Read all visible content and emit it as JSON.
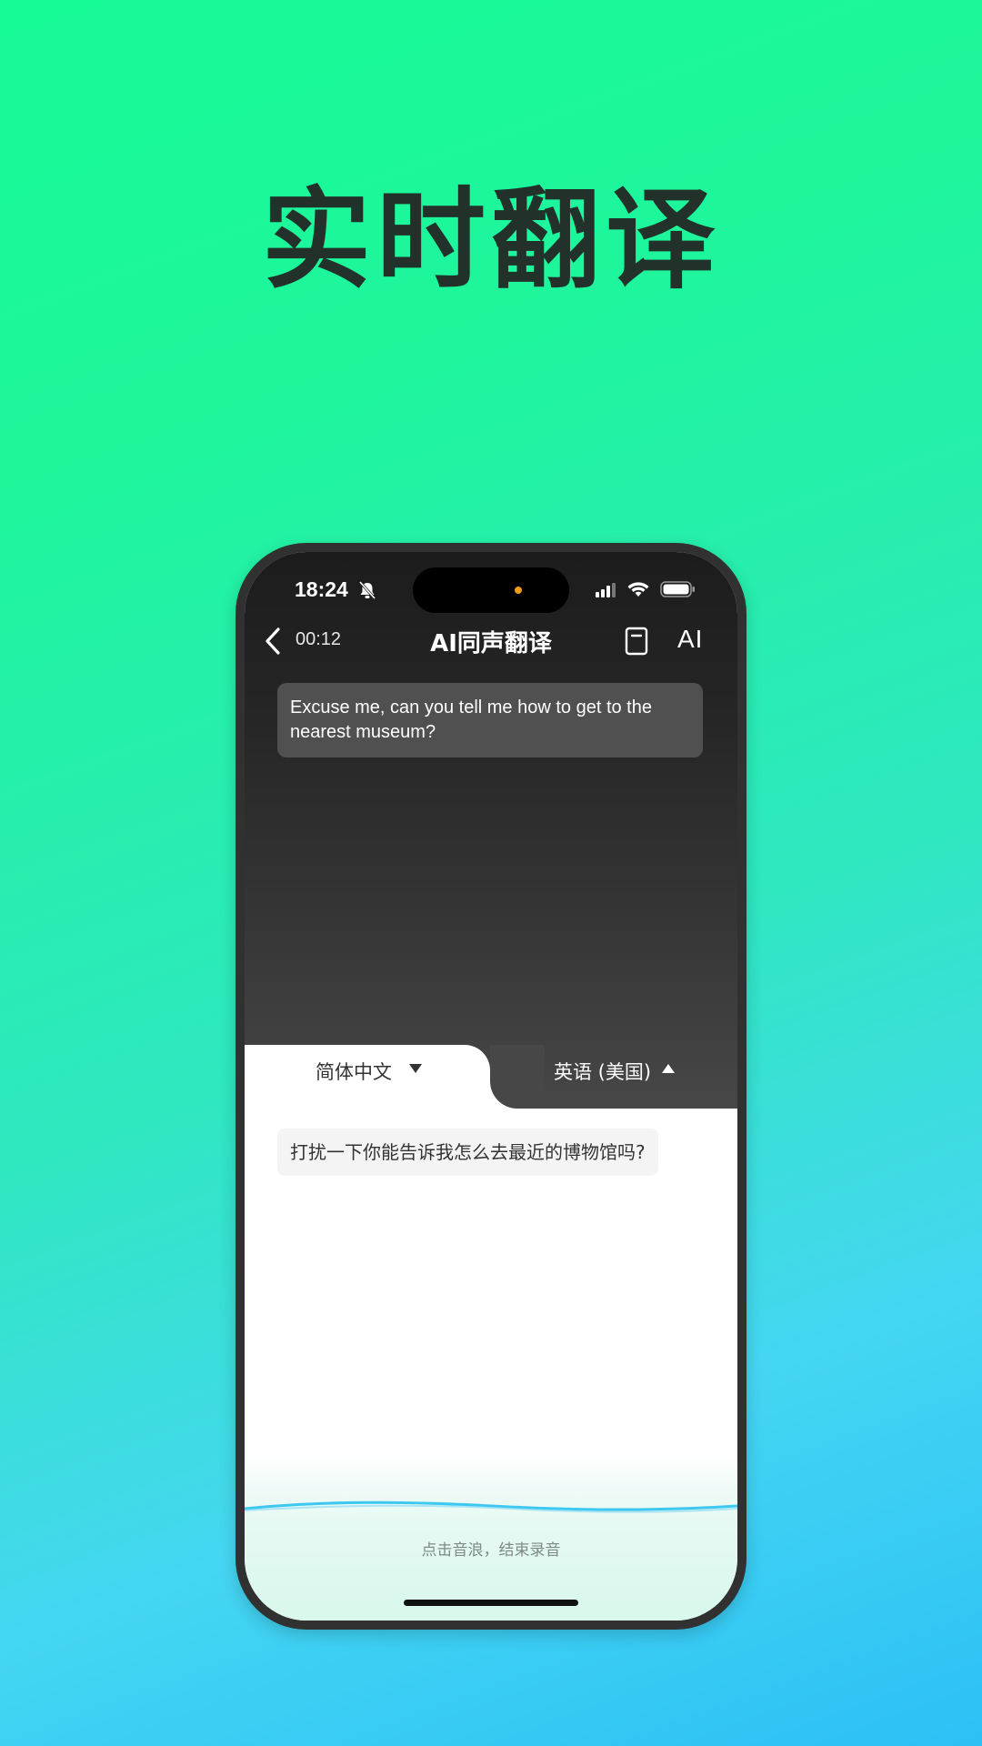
{
  "headline": "实时翻译",
  "status_bar": {
    "time": "18:24"
  },
  "nav": {
    "timer": "00:12",
    "title": "AI同声翻译",
    "right_glyph": "AI"
  },
  "conversation": {
    "source_text": "Excuse me, can you tell me how to get to the nearest museum?",
    "translated_text": "打扰一下你能告诉我怎么去最近的博物馆吗?"
  },
  "languages": {
    "left": "简体中文",
    "right": "英语 (美国)"
  },
  "recorder": {
    "hint": "点击音浪，结束录音"
  },
  "colors": {
    "accent_green": "#16fb96",
    "accent_blue": "#45d6f2",
    "wave_blue": "#3cc8f0"
  },
  "icons": {
    "bell": "bell-slash-icon",
    "signal": "signal-bars-icon",
    "wifi": "wifi-icon",
    "battery": "battery-icon",
    "back": "chevron-left-icon",
    "doc": "document-icon",
    "caret_down": "caret-down-icon",
    "caret_up": "caret-up-icon"
  }
}
